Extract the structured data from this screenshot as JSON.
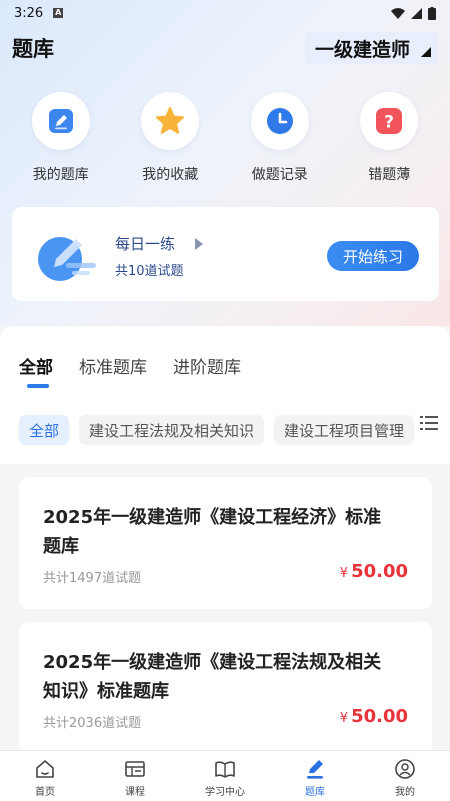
{
  "status": {
    "time": "3:26"
  },
  "header": {
    "title": "题库",
    "exam_selector": "一级建造师"
  },
  "quick_actions": [
    {
      "label": "我的题库",
      "icon": "edit-icon"
    },
    {
      "label": "我的收藏",
      "icon": "star-icon"
    },
    {
      "label": "做题记录",
      "icon": "clock-icon"
    },
    {
      "label": "错题薄",
      "icon": "question-icon"
    }
  ],
  "daily_practice": {
    "title": "每日一练",
    "subtitle": "共10道试题",
    "button": "开始练习"
  },
  "tabs": [
    "全部",
    "标准题库",
    "进阶题库"
  ],
  "chips": [
    "全部",
    "建设工程法规及相关知识",
    "建设工程项目管理"
  ],
  "courses": [
    {
      "title": "2025年一级建造师《建设工程经济》标准题库",
      "count": "共计1497道试题",
      "currency": "¥",
      "price": "50.00"
    },
    {
      "title": "2025年一级建造师《建设工程法规及相关知识》标准题库",
      "count": "共计2036道试题",
      "currency": "¥",
      "price": "50.00"
    }
  ],
  "bottom_nav": [
    {
      "label": "首页",
      "icon": "home-icon"
    },
    {
      "label": "课程",
      "icon": "course-icon"
    },
    {
      "label": "学习中心",
      "icon": "book-icon"
    },
    {
      "label": "题库",
      "icon": "pen-icon",
      "active": true
    },
    {
      "label": "我的",
      "icon": "profile-icon"
    }
  ],
  "colors": {
    "accent": "#2b7ce9",
    "price": "#e8333a"
  }
}
